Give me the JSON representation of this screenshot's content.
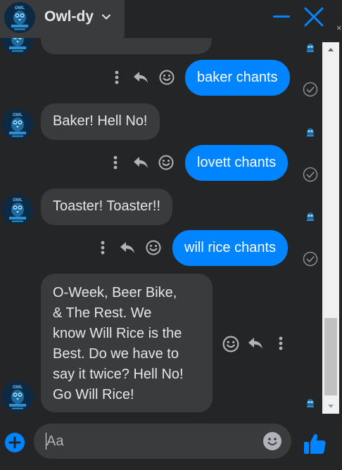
{
  "header": {
    "title": "Owl-dy",
    "avatar_text": "OWL",
    "icons": {
      "chevron": "chevron-down-icon",
      "minimize": "minimize-icon",
      "close": "close-icon"
    }
  },
  "messages": [
    {
      "direction": "outgoing",
      "text": "baker chants",
      "status": "sent-check"
    },
    {
      "direction": "incoming",
      "text": "Baker! Hell No!"
    },
    {
      "direction": "outgoing",
      "text": "lovett chants",
      "status": "sent-check"
    },
    {
      "direction": "incoming",
      "text": "Toaster! Toaster!!"
    },
    {
      "direction": "outgoing",
      "text": "will rice chants",
      "status": "sent-check"
    },
    {
      "direction": "incoming",
      "lines": [
        "O-Week, Beer Bike,",
        "& The Rest. We",
        "know Will Rice is the",
        "Best. Do we have to",
        "say it twice? Hell No!",
        "Go Will Rice!"
      ]
    }
  ],
  "composer": {
    "placeholder": "Aa",
    "icons": {
      "add": "plus-icon",
      "emoji": "emoji-icon",
      "send": "thumbs-up-icon"
    }
  },
  "colors": {
    "background": "#242526",
    "incoming_bubble": "#3a3b3c",
    "outgoing_bubble": "#0084ff",
    "accent": "#0084ff"
  }
}
